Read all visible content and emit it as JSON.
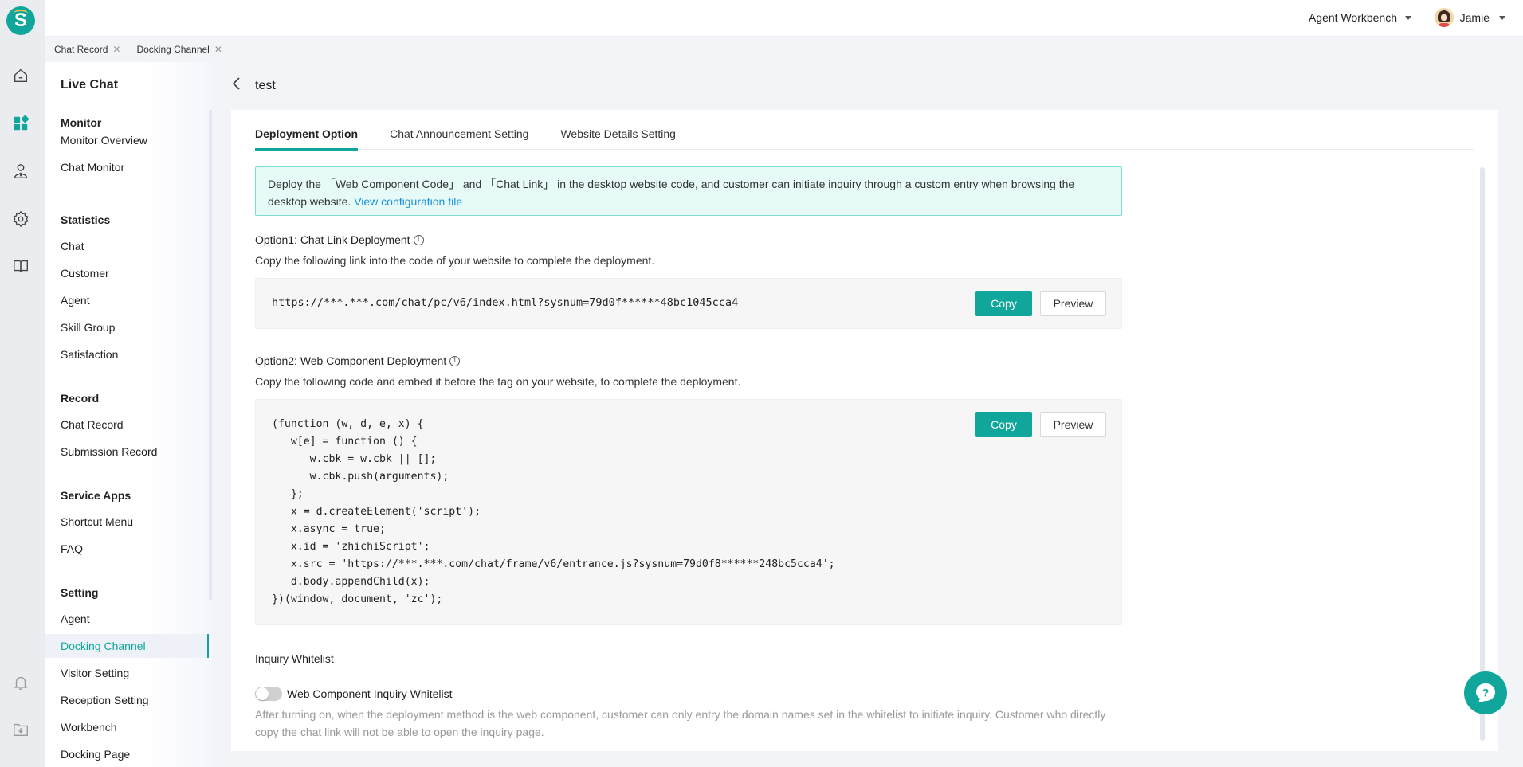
{
  "app": {
    "logo_letter": "S"
  },
  "rail": {
    "icons": [
      "home-icon",
      "apps-icon",
      "agent-icon",
      "settings-icon",
      "book-icon",
      "bell-icon",
      "download-folder-icon"
    ],
    "active": "apps-icon"
  },
  "topbar": {
    "workbench_label": "Agent Workbench",
    "user_name": "Jamie"
  },
  "open_tabs": [
    {
      "label": "Chat Record"
    },
    {
      "label": "Docking Channel"
    }
  ],
  "sidemenu": {
    "title": "Live Chat",
    "groups": [
      {
        "title": "Monitor",
        "items": [
          "Monitor Overview",
          "Chat Monitor"
        ]
      },
      {
        "title": "Statistics",
        "items": [
          "Chat",
          "Customer",
          "Agent",
          "Skill Group",
          "Satisfaction"
        ]
      },
      {
        "title": "Record",
        "items": [
          "Chat Record",
          "Submission Record"
        ]
      },
      {
        "title": "Service Apps",
        "items": [
          "Shortcut Menu",
          "FAQ"
        ]
      },
      {
        "title": "Setting",
        "items": [
          "Agent",
          "Docking Channel",
          "Visitor Setting",
          "Reception Setting",
          "Workbench",
          "Docking Page"
        ]
      }
    ],
    "active_item": "Docking Channel"
  },
  "page": {
    "title": "test",
    "tabs": [
      {
        "label": "Deployment Option",
        "active": true
      },
      {
        "label": "Chat Announcement Setting",
        "active": false
      },
      {
        "label": "Website Details Setting",
        "active": false
      }
    ],
    "notice": {
      "text": "Deploy the 「Web Component Code」 and 「Chat Link」 in the desktop website code, and customer can initiate inquiry through a custom entry when browsing the desktop website.",
      "link": "View configuration file"
    },
    "option1": {
      "title": "Option1: Chat Link Deployment",
      "description": "Copy the following link into the code of your website to complete the deployment.",
      "link": "https://***.***.com/chat/pc/v6/index.html?sysnum=79d0f******48bc1045cca4",
      "copy_label": "Copy",
      "preview_label": "Preview"
    },
    "option2": {
      "title": "Option2: Web Component Deployment",
      "description": "Copy the following code and embed it before the tag on your website, to complete the deployment.",
      "code": "(function (w, d, e, x) {\n   w[e] = function () {\n      w.cbk = w.cbk || [];\n      w.cbk.push(arguments);\n   };\n   x = d.createElement('script');\n   x.async = true;\n   x.id = 'zhichiScript';\n   x.src = 'https://***.***.com/chat/frame/v6/entrance.js?sysnum=79d0f8******248bc5cca4';\n   d.body.appendChild(x);\n})(window, document, 'zc');",
      "copy_label": "Copy",
      "preview_label": "Preview"
    },
    "whitelist": {
      "title": "Inquiry Whitelist",
      "toggle_label": "Web Component Inquiry Whitelist",
      "toggle_on": false,
      "helper": "After turning on, when the deployment method is the web component, customer can only entry the domain names set in the whitelist to initiate inquiry. Customer who directly copy the chat link will not be able to open the inquiry page."
    }
  },
  "colors": {
    "accent": "#10a69b",
    "link": "#1a8fdc",
    "notice_bg": "#e6fbf8",
    "notice_border": "#80dcd3"
  }
}
